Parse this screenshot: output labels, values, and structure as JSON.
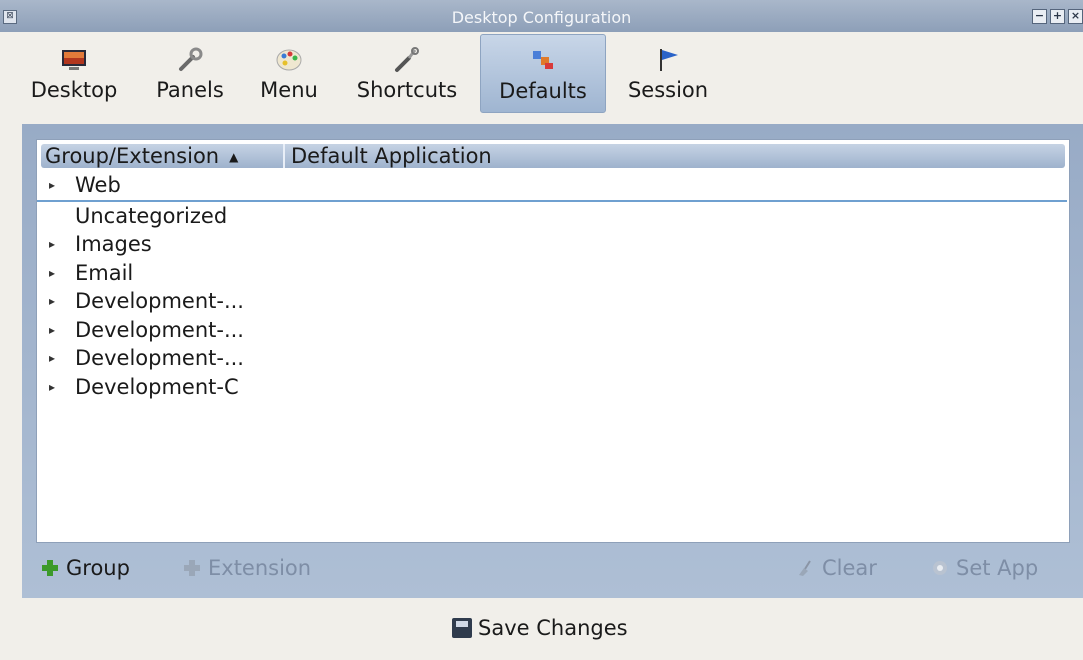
{
  "window": {
    "title": "Desktop Configuration",
    "menu_glyph": "⊠",
    "controls": {
      "minimize": "−",
      "maximize": "+",
      "close": "×"
    }
  },
  "toolbar": {
    "active": "Defaults",
    "items": [
      {
        "label": "Desktop",
        "icon": "desktop-wallpaper-icon"
      },
      {
        "label": "Panels",
        "icon": "wrench-icon"
      },
      {
        "label": "Menu",
        "icon": "palette-icon"
      },
      {
        "label": "Shortcuts",
        "icon": "tools-icon"
      },
      {
        "label": "Defaults",
        "icon": "apps-icon"
      },
      {
        "label": "Session",
        "icon": "flag-icon"
      }
    ]
  },
  "tree": {
    "columns": {
      "group_extension": "Group/Extension",
      "default_application": "Default Application"
    },
    "sort_glyph": "▲",
    "expander_glyph": "▸",
    "rows": [
      {
        "label": "Web",
        "expandable": true
      },
      {
        "label": "Uncategorized",
        "expandable": false
      },
      {
        "label": "Images",
        "expandable": true
      },
      {
        "label": "Email",
        "expandable": true
      },
      {
        "label": "Development-...",
        "expandable": true
      },
      {
        "label": "Development-...",
        "expandable": true
      },
      {
        "label": "Development-...",
        "expandable": true
      },
      {
        "label": "Development-C",
        "expandable": true
      }
    ]
  },
  "actions": {
    "group": "Group",
    "extension": "Extension",
    "clear": "Clear",
    "set_app": "Set App"
  },
  "footer": {
    "save": "Save Changes"
  },
  "colors": {
    "accent": "#9fb5d1",
    "panel": "#a6b8d0",
    "add_green": "#3c9a2a",
    "disabled": "#7e8ea6"
  }
}
